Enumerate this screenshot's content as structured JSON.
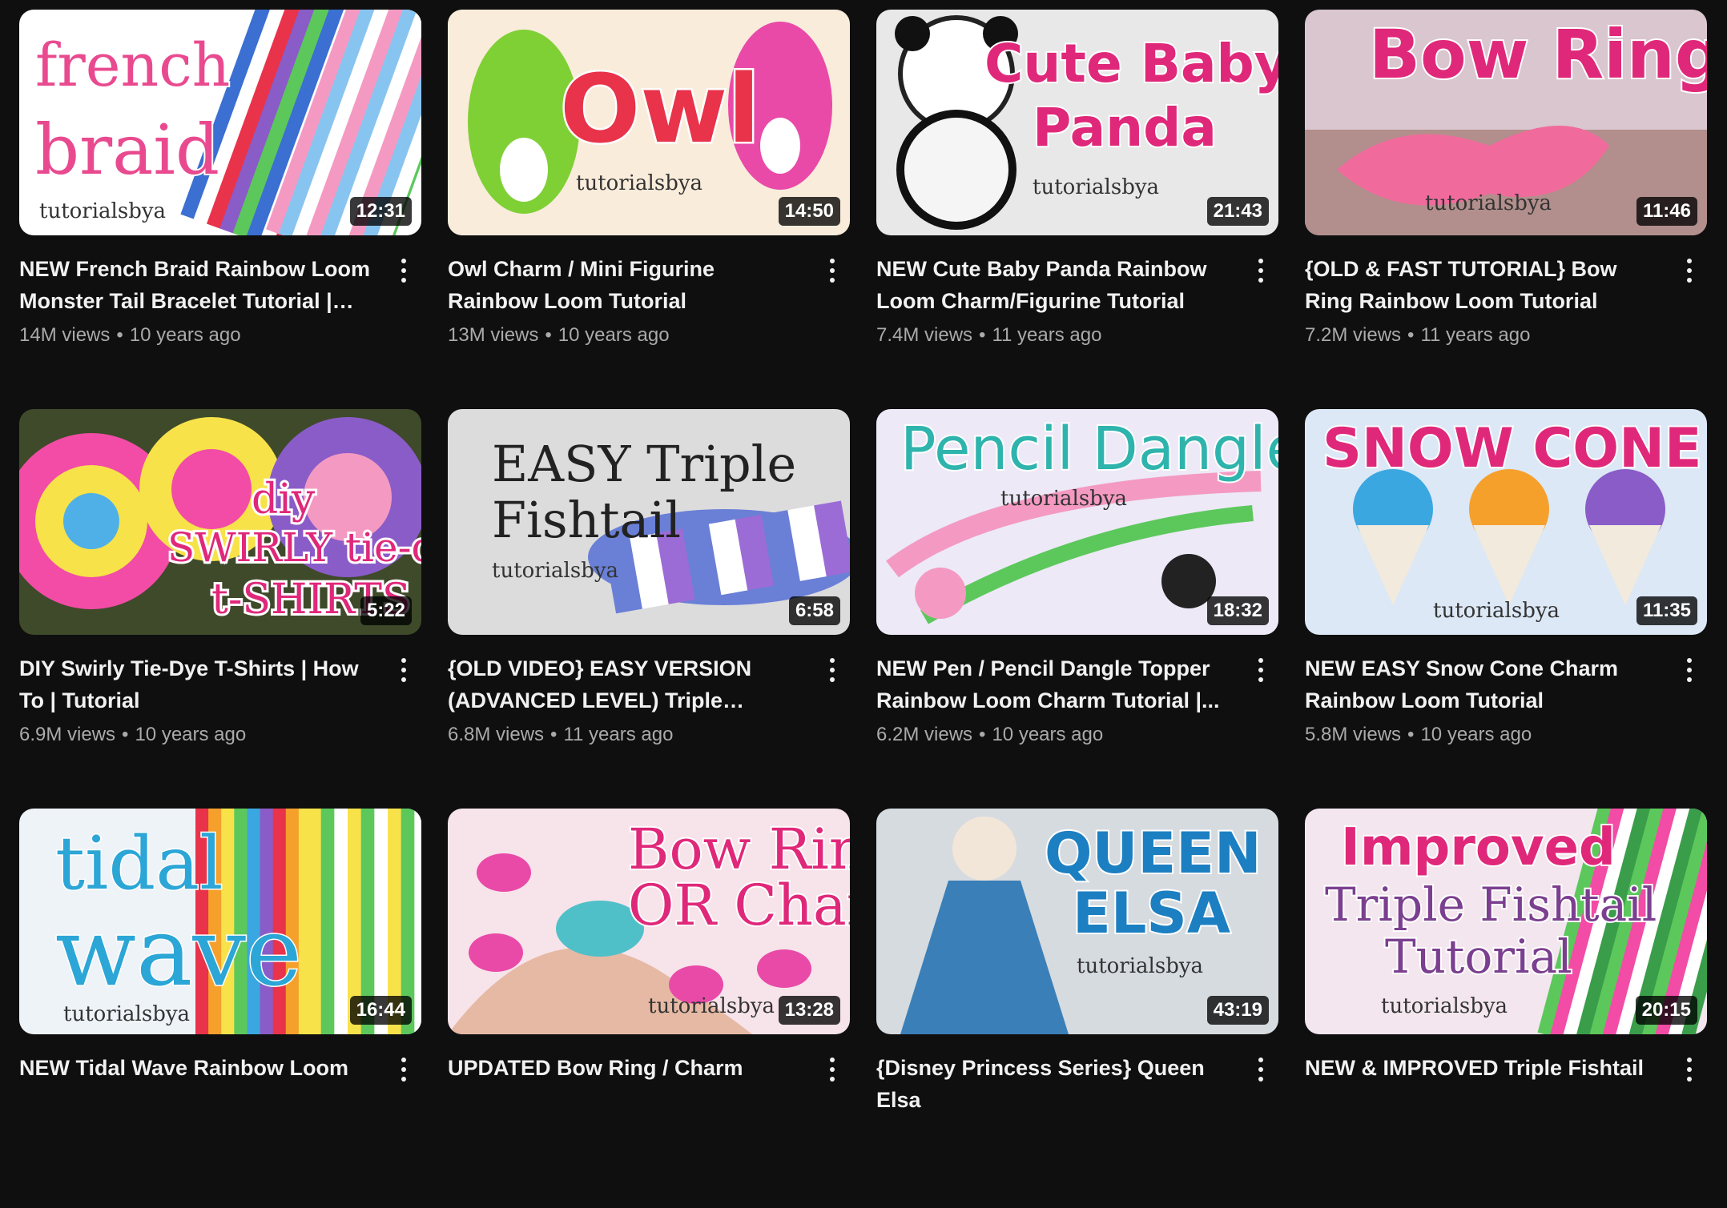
{
  "videos": [
    {
      "thumb_text": [
        "french",
        "braid"
      ],
      "watermark": "tutorialsbya",
      "theme": "braid",
      "colors": [
        "#ffffff",
        "#f4d6ea",
        "#e94a8f"
      ],
      "duration": "12:31",
      "title": "NEW French Braid Rainbow Loom Monster Tail Bracelet Tutorial | Ho...",
      "views": "14M views",
      "age": "10 years ago"
    },
    {
      "thumb_text": [
        "Owl"
      ],
      "watermark": "tutorialsbya",
      "theme": "owl",
      "colors": [
        "#f7f3c8",
        "#fbe5ee",
        "#e8334a"
      ],
      "duration": "14:50",
      "title": "Owl Charm / Mini Figurine Rainbow Loom Tutorial",
      "views": "13M views",
      "age": "10 years ago"
    },
    {
      "thumb_text": [
        "Cute Baby",
        "Panda"
      ],
      "watermark": "tutorialsbya",
      "theme": "panda",
      "colors": [
        "#e8e8e8",
        "#cfcfcf",
        "#e0287a"
      ],
      "duration": "21:43",
      "title": "NEW Cute Baby Panda Rainbow Loom Charm/Figurine Tutorial",
      "views": "7.4M views",
      "age": "11 years ago"
    },
    {
      "thumb_text": [
        "Bow Ring"
      ],
      "watermark": "tutorialsbya",
      "theme": "bowring",
      "colors": [
        "#d9c6cf",
        "#b28f8c",
        "#e0287a"
      ],
      "duration": "11:46",
      "title": "{OLD & FAST TUTORIAL} Bow Ring Rainbow Loom Tutorial",
      "views": "7.2M views",
      "age": "11 years ago"
    },
    {
      "thumb_text": [
        "diy",
        "SWIRLY tie-dye",
        "t-SHIRTS"
      ],
      "watermark": "",
      "theme": "tiedye",
      "colors": [
        "#3e4a2a",
        "#f24ca6",
        "#e0287a"
      ],
      "duration": "5:22",
      "title": "DIY Swirly Tie-Dye T-Shirts | How To | Tutorial",
      "views": "6.9M views",
      "age": "10 years ago"
    },
    {
      "thumb_text": [
        "EASY Triple",
        "Fishtail"
      ],
      "watermark": "tutorialsbya",
      "theme": "fishtail",
      "colors": [
        "#dcdcdc",
        "#c8c8c8",
        "#222222"
      ],
      "duration": "6:58",
      "title": "{OLD VIDEO} EASY VERSION (ADVANCED LEVEL) Triple Fishtail...",
      "views": "6.8M views",
      "age": "11 years ago"
    },
    {
      "thumb_text": [
        "Pencil Dangle"
      ],
      "watermark": "tutorialsbya",
      "theme": "pencil",
      "colors": [
        "#e7e1f2",
        "#f2eefa",
        "#2fb4ad"
      ],
      "duration": "18:32",
      "title": "NEW Pen / Pencil Dangle Topper Rainbow Loom Charm Tutorial |...",
      "views": "6.2M views",
      "age": "10 years ago"
    },
    {
      "thumb_text": [
        "SNOW CONE"
      ],
      "watermark": "tutorialsbya",
      "theme": "snowcone",
      "colors": [
        "#dce8f6",
        "#eef4fb",
        "#e0287a"
      ],
      "duration": "11:35",
      "title": "NEW EASY Snow Cone Charm Rainbow Loom Tutorial",
      "views": "5.8M views",
      "age": "10 years ago"
    },
    {
      "thumb_text": [
        "tidal",
        "wave"
      ],
      "watermark": "tutorialsbya",
      "theme": "tidal",
      "colors": [
        "#eef3f7",
        "#dbe3ea",
        "#2ba6d6"
      ],
      "duration": "16:44",
      "title": "NEW Tidal Wave Rainbow Loom",
      "views": "",
      "age": ""
    },
    {
      "thumb_text": [
        "Bow Ring",
        "OR Charm"
      ],
      "watermark": "tutorialsbya",
      "theme": "bowcharm",
      "colors": [
        "#f7e3ea",
        "#e9c8c8",
        "#e0287a"
      ],
      "duration": "13:28",
      "title": "UPDATED Bow Ring / Charm",
      "views": "",
      "age": ""
    },
    {
      "thumb_text": [
        "QUEEN",
        "ELSA"
      ],
      "watermark": "tutorialsbya",
      "theme": "elsa",
      "colors": [
        "#d6dbe0",
        "#eef1f4",
        "#1c7fc1"
      ],
      "duration": "43:19",
      "title": "{Disney Princess Series} Queen Elsa",
      "views": "",
      "age": ""
    },
    {
      "thumb_text": [
        "Improved",
        "Triple Fishtail",
        "Tutorial"
      ],
      "watermark": "tutorialsbya",
      "theme": "improved",
      "colors": [
        "#f3e6ee",
        "#f9f1f5",
        "#7b3f8f"
      ],
      "duration": "20:15",
      "title": "NEW & IMPROVED Triple Fishtail",
      "views": "",
      "age": ""
    }
  ]
}
